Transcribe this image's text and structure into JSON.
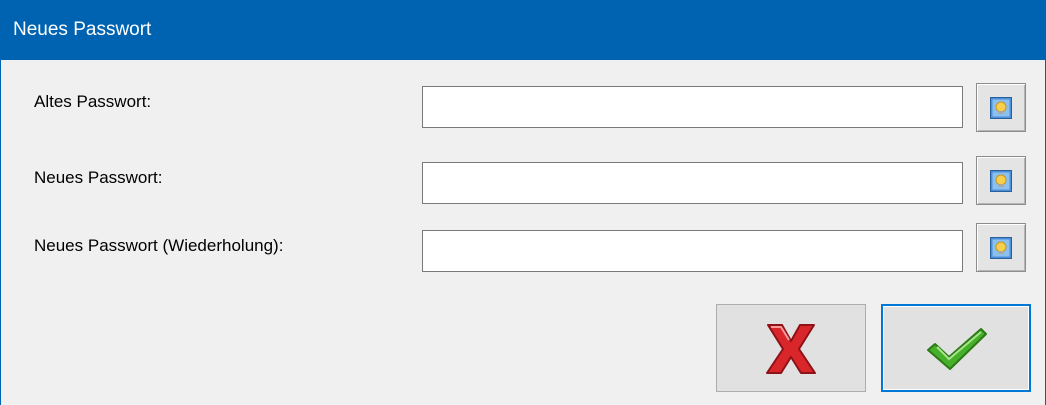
{
  "window": {
    "title": "Neues Passwort"
  },
  "fields": [
    {
      "label": "Altes Passwort:",
      "value": "",
      "reveal_icon": "show-password-icon"
    },
    {
      "label": "Neues Passwort:",
      "value": "",
      "reveal_icon": "show-password-icon"
    },
    {
      "label": "Neues Passwort (Wiederholung):",
      "value": "",
      "reveal_icon": "show-password-icon"
    }
  ],
  "actions": {
    "cancel_icon": "red-x-icon",
    "confirm_icon": "green-checkmark-icon"
  },
  "colors": {
    "titlebar": "#0063b1",
    "background": "#f0f0f0",
    "cancel": "#d9262b",
    "confirm": "#47b02a",
    "focus_border": "#0078d7"
  }
}
